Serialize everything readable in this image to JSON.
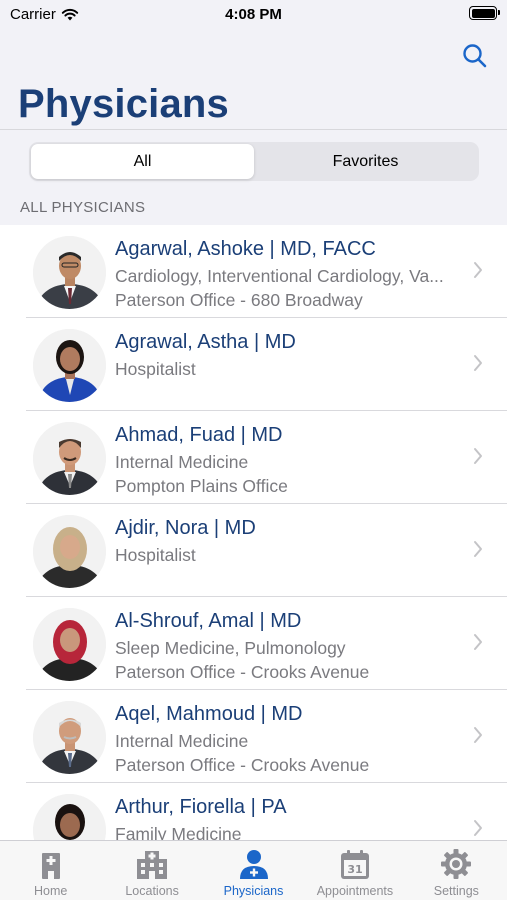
{
  "status_bar": {
    "carrier": "Carrier",
    "time": "4:08 PM"
  },
  "header": {
    "title": "Physicians",
    "search_icon": "search-icon"
  },
  "segments": [
    {
      "label": "All",
      "selected": true
    },
    {
      "label": "Favorites",
      "selected": false
    }
  ],
  "section": {
    "header": "ALL PHYSICIANS"
  },
  "physicians": [
    {
      "name": "Agarwal, Ashoke | MD, FACC",
      "specialty": "Cardiology, Interventional Cardiology, Va...",
      "office": "Paterson Office - 680 Broadway"
    },
    {
      "name": "Agrawal, Astha | MD",
      "specialty": "Hospitalist",
      "office": ""
    },
    {
      "name": "Ahmad, Fuad | MD",
      "specialty": "Internal Medicine",
      "office": "Pompton Plains Office"
    },
    {
      "name": "Ajdir, Nora | MD",
      "specialty": "Hospitalist",
      "office": ""
    },
    {
      "name": "Al-Shrouf, Amal | MD",
      "specialty": "Sleep Medicine, Pulmonology",
      "office": "Paterson Office - Crooks Avenue"
    },
    {
      "name": "Aqel, Mahmoud | MD",
      "specialty": "Internal Medicine",
      "office": "Paterson Office - Crooks Avenue"
    },
    {
      "name": "Arthur, Fiorella | PA",
      "specialty": "Family Medicine",
      "office": ""
    }
  ],
  "tabbar": [
    {
      "label": "Home",
      "icon": "home-icon",
      "active": false
    },
    {
      "label": "Locations",
      "icon": "hospital-building-icon",
      "active": false
    },
    {
      "label": "Physicians",
      "icon": "physician-icon",
      "active": true
    },
    {
      "label": "Appointments",
      "icon": "calendar-icon",
      "active": false
    },
    {
      "label": "Settings",
      "icon": "gear-icon",
      "active": false
    }
  ],
  "colors": {
    "brand": "#1b3f77",
    "active_tab": "#1b66c9",
    "inactive_tab": "#8e8e93",
    "secondary_text": "#7a7a7f"
  }
}
